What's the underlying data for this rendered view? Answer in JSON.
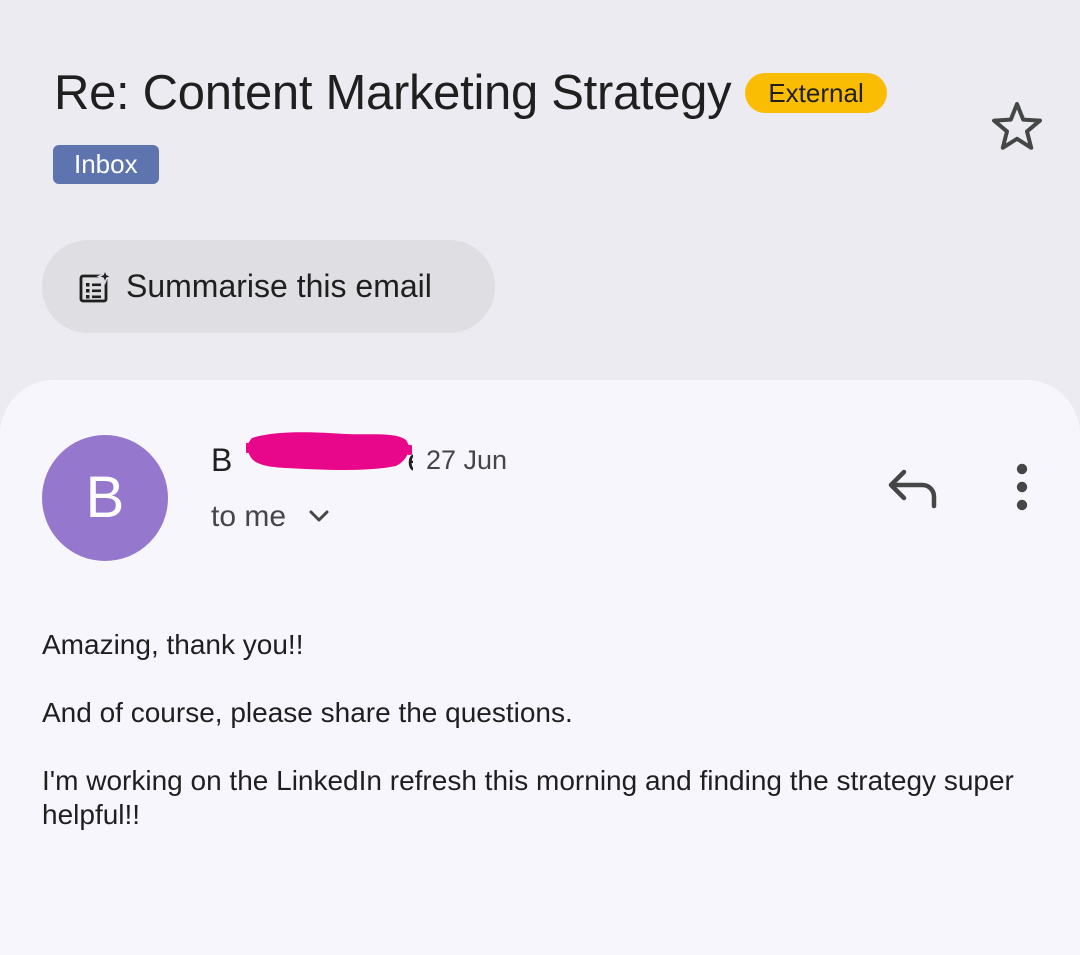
{
  "email": {
    "subject": "Re: Content Marketing Strategy",
    "external_badge": "External",
    "label_chip": "Inbox",
    "star_icon": "star-outline-icon"
  },
  "summarise": {
    "label": "Summarise this email",
    "icon": "summarise-sparkle-icon"
  },
  "message": {
    "avatar_letter": "B",
    "sender_visible_start": "B",
    "sender_visible_end": "e",
    "date": "27 Jun",
    "recipient": "to me",
    "reply_icon": "reply-icon",
    "more_icon": "more-vert-icon",
    "body": [
      "Amazing, thank you!!",
      "And of course, please share the questions.",
      "I'm working on the LinkedIn refresh this morning and finding the strategy super helpful!!"
    ]
  },
  "colors": {
    "background": "#ECEBF1",
    "card": "#F7F6FC",
    "external_badge": "#FBBC04",
    "inbox_chip": "#5E74AE",
    "avatar": "#9578CD",
    "redaction": "#E8078A"
  }
}
